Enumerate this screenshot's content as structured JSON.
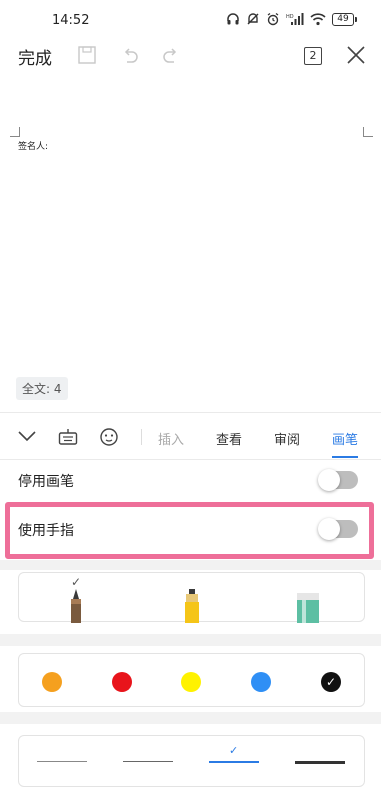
{
  "status_bar": {
    "time": "14:52",
    "battery_level": "49",
    "icons": [
      "headphones-icon",
      "mute-icon",
      "alarm-icon",
      "signal-icon",
      "wifi-icon",
      "battery-icon"
    ]
  },
  "toolbar": {
    "done_label": "完成",
    "page_count": "2",
    "icons": [
      "save-icon",
      "undo-icon",
      "redo-icon",
      "close-icon"
    ]
  },
  "document": {
    "signer_label": "签名人:",
    "word_count": "全文: 4"
  },
  "bottom_tabs": {
    "icons": [
      "collapse-chevron-icon",
      "keyboard-icon",
      "face-icon"
    ],
    "tabs": [
      {
        "label": "插入",
        "state": "disabled"
      },
      {
        "label": "查看",
        "state": "normal"
      },
      {
        "label": "审阅",
        "state": "normal"
      },
      {
        "label": "画笔",
        "state": "active"
      }
    ]
  },
  "settings": {
    "disable_pen_label": "停用画笔",
    "disable_pen_on": false,
    "use_finger_label": "使用手指",
    "use_finger_on": false
  },
  "pens": [
    {
      "name": "pencil",
      "selected": true,
      "color": "#7a5a3e"
    },
    {
      "name": "highlighter",
      "selected": false,
      "color": "#f5c518"
    },
    {
      "name": "eraser",
      "selected": false,
      "color": "#5dbfa3"
    }
  ],
  "colors": [
    {
      "name": "orange",
      "hex": "#f5a01f",
      "selected": false
    },
    {
      "name": "red",
      "hex": "#e8141b",
      "selected": false
    },
    {
      "name": "yellow",
      "hex": "#fff200",
      "selected": false
    },
    {
      "name": "blue",
      "hex": "#2f8ff5",
      "selected": false
    },
    {
      "name": "black",
      "hex": "#111111",
      "selected": true
    }
  ],
  "line_widths": [
    {
      "name": "thin",
      "selected": false
    },
    {
      "name": "medium",
      "selected": false
    },
    {
      "name": "thick",
      "selected": true
    },
    {
      "name": "extra-thick",
      "selected": false
    }
  ],
  "accent_color": "#2b7be4",
  "highlight_color": "#ee6f99"
}
